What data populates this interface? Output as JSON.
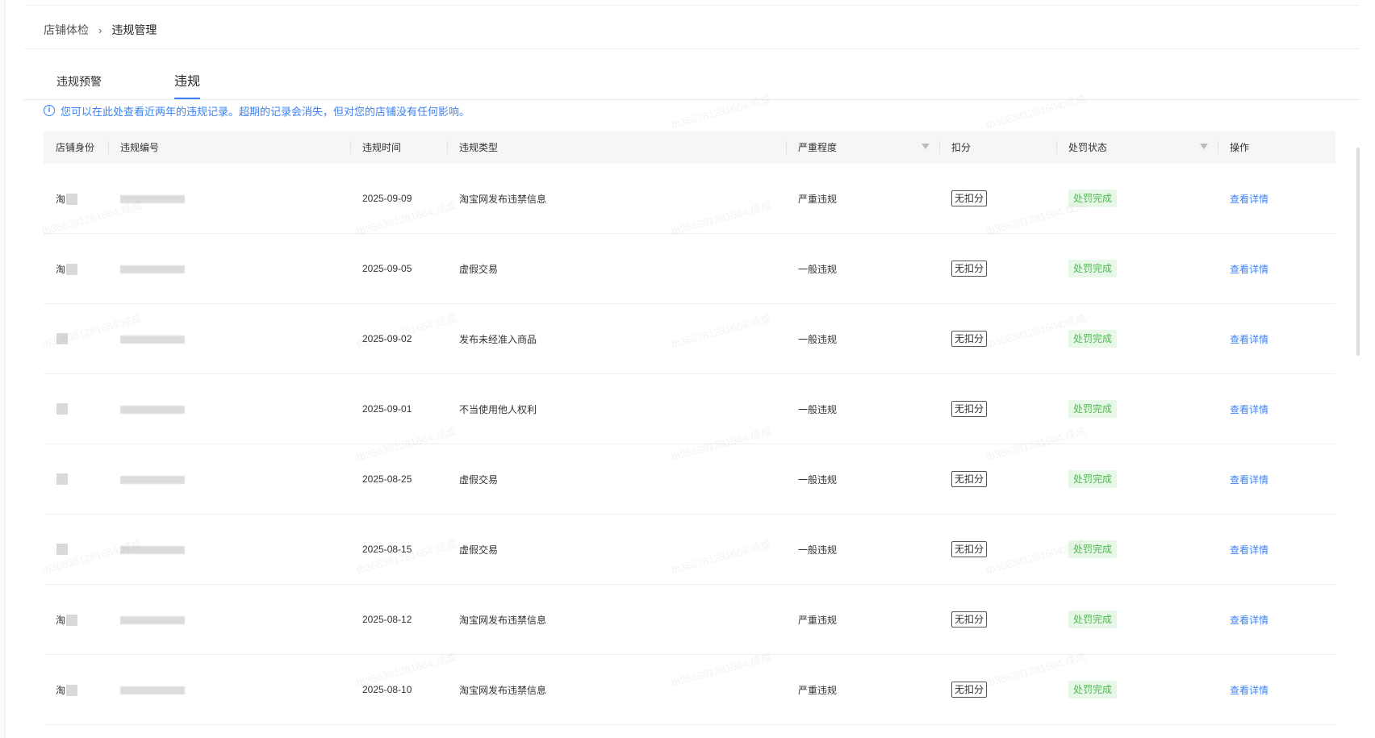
{
  "breadcrumb": {
    "parent": "店铺体检",
    "separator": "›",
    "current": "违规管理"
  },
  "tabs": [
    {
      "label": "违规预警",
      "active": false
    },
    {
      "label": "违规",
      "active": true
    }
  ],
  "notice": {
    "icon": "info-icon",
    "text": "您可以在此处查看近两年的违规记录。超期的记录会消失，但对您的店铺没有任何影响。"
  },
  "table": {
    "headers": {
      "identity": "店铺身份",
      "violation_id": "违规编号",
      "time": "违规时间",
      "type": "违规类型",
      "severity": "严重程度",
      "score": "扣分",
      "status": "处罚状态",
      "action": "操作"
    },
    "rows": [
      {
        "identity": "淘",
        "time": "2025-09-09",
        "type": "淘宝网发布违禁信息",
        "severity": "严重违规",
        "score": "无扣分",
        "status": "处罚完成",
        "action": "查看详情"
      },
      {
        "identity": "淘",
        "time": "2025-09-05",
        "type": "虚假交易",
        "severity": "一般违规",
        "score": "无扣分",
        "status": "处罚完成",
        "action": "查看详情"
      },
      {
        "identity": "",
        "time": "2025-09-02",
        "type": "发布未经准入商品",
        "severity": "一般违规",
        "score": "无扣分",
        "status": "处罚完成",
        "action": "查看详情"
      },
      {
        "identity": "",
        "time": "2025-09-01",
        "type": "不当使用他人权利",
        "severity": "一般违规",
        "score": "无扣分",
        "status": "处罚完成",
        "action": "查看详情"
      },
      {
        "identity": "",
        "time": "2025-08-25",
        "type": "虚假交易",
        "severity": "一般违规",
        "score": "无扣分",
        "status": "处罚完成",
        "action": "查看详情"
      },
      {
        "identity": "",
        "time": "2025-08-15",
        "type": "虚假交易",
        "severity": "一般违规",
        "score": "无扣分",
        "status": "处罚完成",
        "action": "查看详情"
      },
      {
        "identity": "淘",
        "time": "2025-08-12",
        "type": "淘宝网发布违禁信息",
        "severity": "严重违规",
        "score": "无扣分",
        "status": "处罚完成",
        "action": "查看详情"
      },
      {
        "identity": "淘",
        "time": "2025-08-10",
        "type": "淘宝网发布违禁信息",
        "severity": "严重违规",
        "score": "无扣分",
        "status": "处罚完成",
        "action": "查看详情"
      }
    ]
  },
  "watermark": "tb366381281664:成成",
  "colors": {
    "accent": "#3b82f6",
    "status_bg": "#e8f8e8",
    "status_text": "#4cbb4c"
  }
}
